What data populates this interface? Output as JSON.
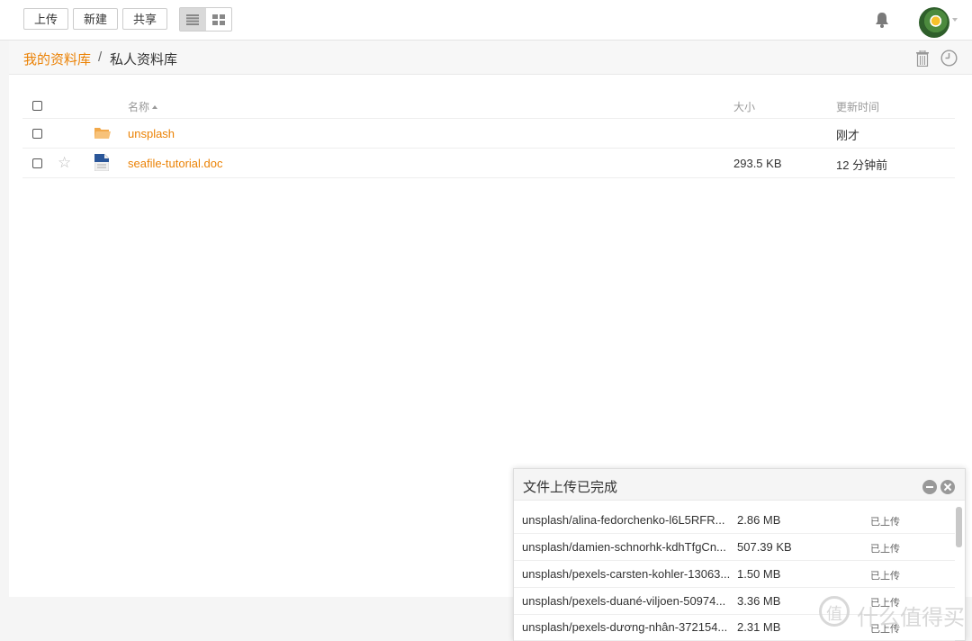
{
  "toolbar": {
    "upload_label": "上传",
    "new_label": "新建",
    "share_label": "共享",
    "view_modes": [
      "list",
      "grid"
    ],
    "active_view": "list"
  },
  "breadcrumb": {
    "root": "我的资料库",
    "separator": "/",
    "current": "私人资料库"
  },
  "table": {
    "headers": {
      "name": "名称",
      "size": "大小",
      "modified": "更新时间"
    },
    "rows": [
      {
        "type": "folder",
        "name": "unsplash",
        "size": "",
        "modified": "刚才",
        "starred": false
      },
      {
        "type": "file",
        "name": "seafile-tutorial.doc",
        "size": "293.5 KB",
        "modified": "12 分钟前",
        "starred": false
      }
    ]
  },
  "upload_panel": {
    "title": "文件上传已完成",
    "items": [
      {
        "name": "unsplash/alina-fedorchenko-l6L5RFR...",
        "size": "2.86 MB",
        "status": "已上传"
      },
      {
        "name": "unsplash/damien-schnorhk-kdhTfgCn...",
        "size": "507.39 KB",
        "status": "已上传"
      },
      {
        "name": "unsplash/pexels-carsten-kohler-13063...",
        "size": "1.50 MB",
        "status": "已上传"
      },
      {
        "name": "unsplash/pexels-duané-viljoen-50974...",
        "size": "3.36 MB",
        "status": "已上传"
      },
      {
        "name": "unsplash/pexels-dương-nhân-372154...",
        "size": "2.31 MB",
        "status": "已上传"
      }
    ]
  },
  "watermark": {
    "text": "什么值得买"
  },
  "colors": {
    "accent": "#eb8205",
    "folder": "#f2a94a",
    "doc": "#2a5699"
  }
}
